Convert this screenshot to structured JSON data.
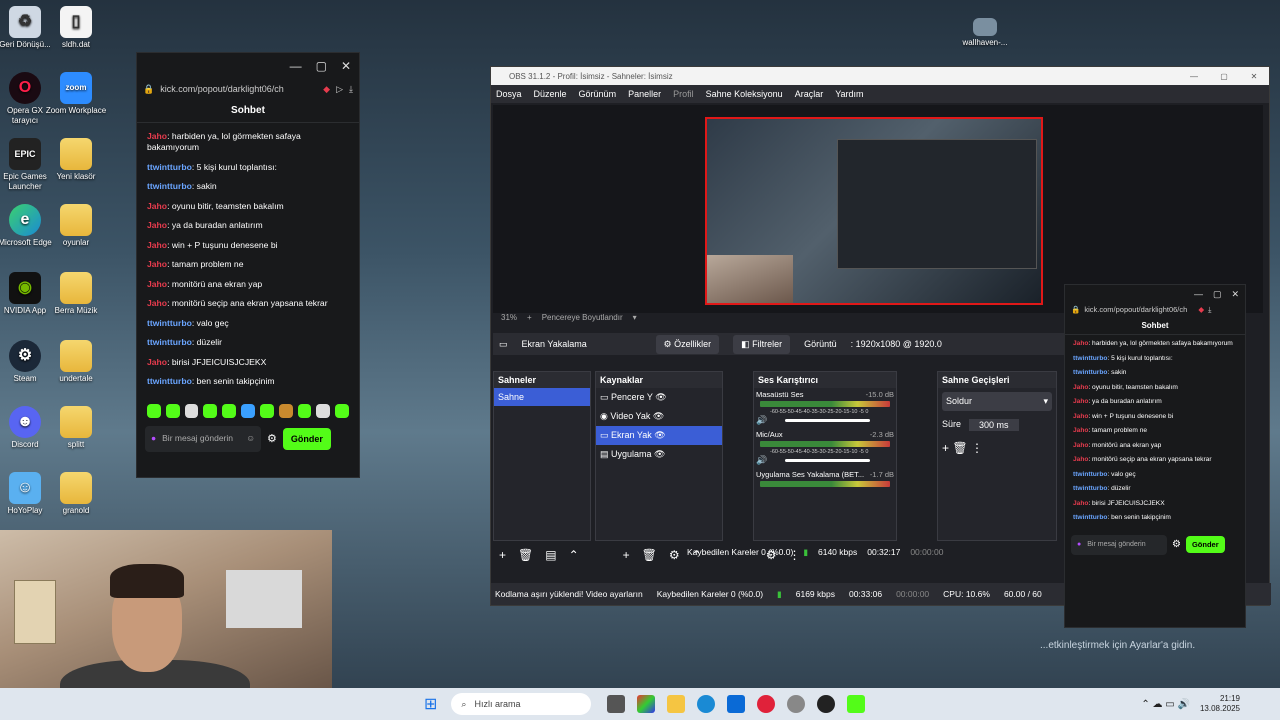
{
  "desktop": {
    "icons": [
      {
        "label": "Geri Dönüşü...",
        "icon": "recycle-bin-icon"
      },
      {
        "label": "sldh.dat",
        "icon": "file-icon"
      },
      {
        "label": "Opera GX tarayıcı",
        "icon": "opera-gx-icon"
      },
      {
        "label": "Zoom Workplace",
        "icon": "zoom-icon"
      },
      {
        "label": "Epic Games Launcher",
        "icon": "epic-games-icon"
      },
      {
        "label": "Yeni klasör",
        "icon": "folder-icon"
      },
      {
        "label": "Microsoft Edge",
        "icon": "edge-icon"
      },
      {
        "label": "oyunlar",
        "icon": "folder-icon"
      },
      {
        "label": "NVIDIA App",
        "icon": "nvidia-icon"
      },
      {
        "label": "Berra Müzik",
        "icon": "folder-icon"
      },
      {
        "label": "Steam",
        "icon": "steam-icon"
      },
      {
        "label": "undertale",
        "icon": "folder-icon"
      },
      {
        "label": "Discord",
        "icon": "discord-icon"
      },
      {
        "label": "splitt",
        "icon": "folder-icon"
      },
      {
        "label": "HoYoPlay",
        "icon": "hoyoplay-icon"
      },
      {
        "label": "granold",
        "icon": "folder-icon"
      },
      {
        "label": "wallhaven-...",
        "icon": "image-file-icon"
      }
    ],
    "activate_text": "...etkinleştirmek için Ayarlar'a gidin."
  },
  "kick_popout": {
    "url": "kick.com/popout/darklight06/ch",
    "chat_title": "Sohbet",
    "messages": [
      {
        "user": "Jaho",
        "text": ": harbiden ya, lol görmekten safaya bakamıyorum",
        "type": "u1"
      },
      {
        "user": "ttwintturbo",
        "text": ": 5 kişi kurul toplantısı:",
        "type": "u2"
      },
      {
        "user": "ttwintturbo",
        "text": ": sakin",
        "type": "u2"
      },
      {
        "user": "Jaho",
        "text": ": oyunu bitir, teamsten bakalım",
        "type": "u1"
      },
      {
        "user": "Jaho",
        "text": ": ya da buradan anlatırım",
        "type": "u1"
      },
      {
        "user": "Jaho",
        "text": ": win + P tuşunu denesene bi",
        "type": "u1"
      },
      {
        "user": "Jaho",
        "text": ": tamam problem ne",
        "type": "u1"
      },
      {
        "user": "Jaho",
        "text": ": monitörü ana ekran yap",
        "type": "u1"
      },
      {
        "user": "Jaho",
        "text": ": monitörü seçip ana ekran yapsana tekrar",
        "type": "u1"
      },
      {
        "user": "ttwintturbo",
        "text": ": valo geç",
        "type": "u2"
      },
      {
        "user": "ttwintturbo",
        "text": ": düzelir",
        "type": "u2"
      },
      {
        "user": "Jaho",
        "text": ": birisi JFJEICUISJCJEKX",
        "type": "u1"
      },
      {
        "user": "ttwintturbo",
        "text": ": ben senin takipçinim",
        "type": "u2"
      }
    ],
    "input_placeholder": "Bir mesaj gönderin",
    "send_label": "Gönder"
  },
  "obs": {
    "title": "OBS 31.1.2 - Profil: İsimsiz - Sahneler: İsimsiz",
    "menu": [
      "Dosya",
      "Düzenle",
      "Görünüm",
      "Paneller",
      "Profil",
      "Sahne Koleksiyonu",
      "Araçlar",
      "Yardım"
    ],
    "zoom": "31%",
    "fit_label": "Pencereye Boyutlandır",
    "source_name": "Ekran Yakalama",
    "properties_label": "Özellikler",
    "filters_label": "Filtreler",
    "display_label": "Görüntü",
    "resolution": ": 1920x1080 @ 1920.0",
    "scenes_header": "Sahneler",
    "scene_item": "Sahne",
    "sources_header": "Kaynaklar",
    "sources": [
      "Pencere Y",
      "Video Yak",
      "Ekran Yak",
      "Uygulama"
    ],
    "mixer_header": "Ses Karıştırıcı",
    "mixer": [
      {
        "name": "Masaüstü Ses",
        "db": "-15.0 dB",
        "level": 0.7
      },
      {
        "name": "Mic/Aux",
        "db": "-2.3 dB",
        "level": 0.8
      },
      {
        "name": "Uygulama Ses Yakalama (BET...",
        "db": "-1.7 dB",
        "level": 0.85
      }
    ],
    "meter_scale": "-60-55-50-45-40-35-30-25-20-15-10 -5 0",
    "transitions_header": "Sahne Geçişleri",
    "transition_value": "Soldur",
    "duration_label": "Süre",
    "duration_value": "300 ms",
    "status_dropped": "Kaybedilen Kareler 0 (%0.0)",
    "status_kbps": "6140 kbps",
    "status_time": "00:32:17",
    "status_rec": "00:00:00",
    "bottom_warning": "Kodlama aşırı yüklendi! Video ayarların",
    "bottom_dropped": "Kaybedilen Kareler 0 (%0.0)",
    "bottom_kbps": "6169 kbps",
    "bottom_time": "00:33:06",
    "bottom_rec": "00:00:00",
    "cpu": "CPU: 10.6%",
    "fps": "60.00 / 60"
  },
  "kick_popout_2": {
    "url": "kick.com/popout/darklight06/ch",
    "chat_title": "Sohbet",
    "input_placeholder": "Bir mesaj gönderin",
    "send_label": "Gönder"
  },
  "taskbar": {
    "search_placeholder": "Hızlı arama",
    "time": "21:19",
    "date": "13.08.2025"
  },
  "colors": {
    "kick_green": "#53fc18",
    "obs_selected": "#3b5ed6",
    "red_user": "#e63b4d",
    "blue_user": "#6aa5ff"
  }
}
